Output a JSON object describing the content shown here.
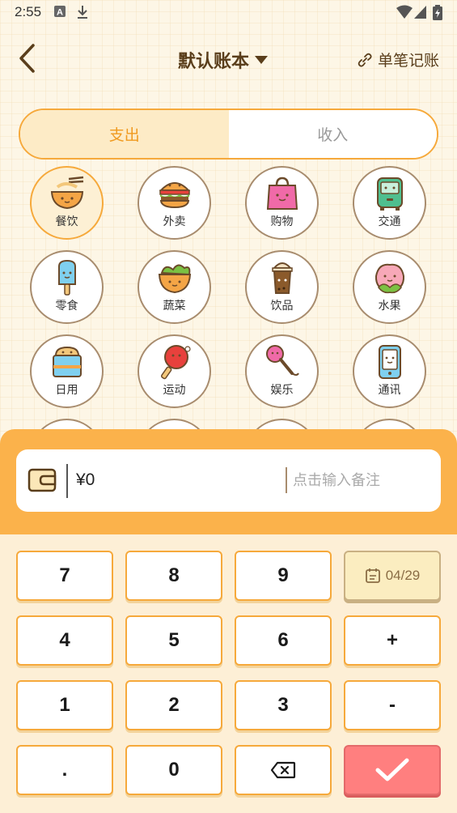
{
  "status_bar": {
    "time": "2:55"
  },
  "header": {
    "title": "默认账本",
    "single_entry_label": "单笔记账"
  },
  "tabs": [
    {
      "label": "支出",
      "active": true
    },
    {
      "label": "收入",
      "active": false
    }
  ],
  "categories": [
    {
      "label": "餐饮",
      "icon": "noodle-bowl-icon",
      "selected": true
    },
    {
      "label": "外卖",
      "icon": "burger-icon",
      "selected": false
    },
    {
      "label": "购物",
      "icon": "shopping-bag-icon",
      "selected": false
    },
    {
      "label": "交通",
      "icon": "bus-icon",
      "selected": false
    },
    {
      "label": "零食",
      "icon": "popsicle-icon",
      "selected": false
    },
    {
      "label": "蔬菜",
      "icon": "vegetable-basket-icon",
      "selected": false
    },
    {
      "label": "饮品",
      "icon": "drink-cup-icon",
      "selected": false
    },
    {
      "label": "水果",
      "icon": "peach-icon",
      "selected": false
    },
    {
      "label": "日用",
      "icon": "daily-goods-icon",
      "selected": false
    },
    {
      "label": "运动",
      "icon": "ping-pong-paddle-icon",
      "selected": false
    },
    {
      "label": "娱乐",
      "icon": "microphone-icon",
      "selected": false
    },
    {
      "label": "通讯",
      "icon": "phone-icon",
      "selected": false
    }
  ],
  "input": {
    "amount": "¥0",
    "note_placeholder": "点击输入备注"
  },
  "keypad": {
    "keys": [
      "7",
      "8",
      "9",
      "4",
      "5",
      "6",
      "+",
      "1",
      "2",
      "3",
      "-",
      ".",
      "0"
    ],
    "date_label": "04/29"
  },
  "colors": {
    "accent": "#f6a93b",
    "panel": "#fbb24b",
    "confirm": "#ff7f7f",
    "brown": "#5a3e1b"
  }
}
